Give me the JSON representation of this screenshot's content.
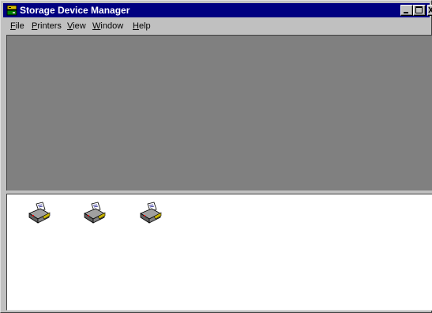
{
  "window": {
    "title": "Storage Device Manager",
    "title_bar_color": "#000080",
    "workspace_color": "#808080",
    "list_background": "#ffffff",
    "app_icon": "storage-manager-icon"
  },
  "menu": {
    "items": [
      {
        "label": "File",
        "hotkey": "F",
        "rest": "ile"
      },
      {
        "label": "Printers",
        "hotkey": "P",
        "rest": "rinters"
      },
      {
        "label": "View",
        "hotkey": "V",
        "rest": "iew"
      },
      {
        "label": "Window",
        "hotkey": "W",
        "rest": "indow"
      },
      {
        "label": "Help",
        "hotkey": "H",
        "rest": "elp"
      }
    ]
  },
  "devices": {
    "icon": "printer-icon",
    "count": 3
  }
}
